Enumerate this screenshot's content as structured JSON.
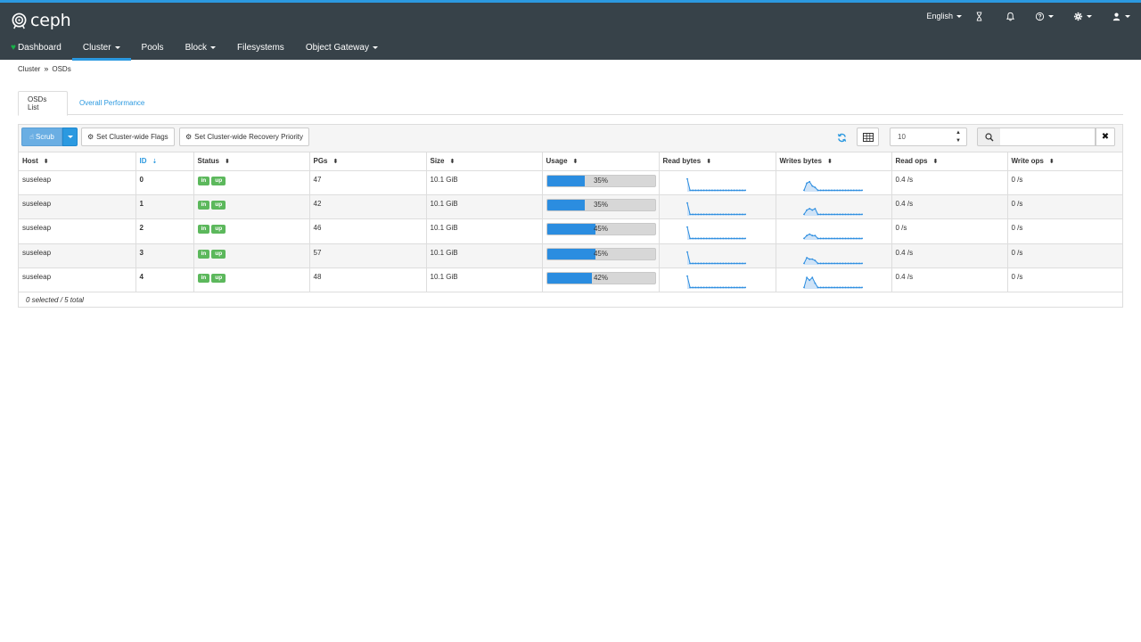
{
  "brand": {
    "name": "ceph"
  },
  "top_utils": {
    "language": "English"
  },
  "nav": {
    "dashboard": "Dashboard",
    "cluster": "Cluster",
    "pools": "Pools",
    "block": "Block",
    "filesystems": "Filesystems",
    "object_gateway": "Object Gateway"
  },
  "breadcrumb": {
    "parent": "Cluster",
    "current": "OSDs"
  },
  "tabs": {
    "osds_list": "OSDs List",
    "overall_performance": "Overall Performance"
  },
  "toolbar": {
    "scrub": "Scrub",
    "set_flags": "Set Cluster-wide Flags",
    "set_recovery": "Set Cluster-wide Recovery Priority",
    "page_limit": "10",
    "search_value": ""
  },
  "table": {
    "columns": {
      "host": "Host",
      "id": "ID",
      "status": "Status",
      "pgs": "PGs",
      "size": "Size",
      "usage": "Usage",
      "read_bytes": "Read bytes",
      "write_bytes": "Writes bytes",
      "read_ops": "Read ops",
      "write_ops": "Write ops"
    },
    "rows": [
      {
        "host": "suseleap",
        "id": "0",
        "status_in": "in",
        "status_up": "up",
        "pgs": "47",
        "size": "10.1 GiB",
        "usage_pct": 35,
        "usage_label": "35%",
        "read_ops": "0.4 /s",
        "write_ops": "0 /s",
        "read_spark": [
          9,
          1,
          1,
          1,
          1,
          1,
          1,
          1,
          1,
          1,
          1,
          1,
          1,
          1,
          1,
          1,
          1,
          1,
          1,
          1,
          1,
          1
        ],
        "write_spark": [
          1,
          6,
          7,
          4,
          3,
          1,
          1,
          1,
          1,
          1,
          1,
          1,
          1,
          1,
          1,
          1,
          1,
          1,
          1,
          1,
          1,
          1
        ]
      },
      {
        "host": "suseleap",
        "id": "1",
        "status_in": "in",
        "status_up": "up",
        "pgs": "42",
        "size": "10.1 GiB",
        "usage_pct": 35,
        "usage_label": "35%",
        "read_ops": "0.4 /s",
        "write_ops": "0 /s",
        "read_spark": [
          9,
          1,
          1,
          1,
          1,
          1,
          1,
          1,
          1,
          1,
          1,
          1,
          1,
          1,
          1,
          1,
          1,
          1,
          1,
          1,
          1,
          1
        ],
        "write_spark": [
          1,
          4,
          5,
          4,
          5,
          1,
          1,
          1,
          1,
          1,
          1,
          1,
          1,
          1,
          1,
          1,
          1,
          1,
          1,
          1,
          1,
          1
        ]
      },
      {
        "host": "suseleap",
        "id": "2",
        "status_in": "in",
        "status_up": "up",
        "pgs": "46",
        "size": "10.1 GiB",
        "usage_pct": 45,
        "usage_label": "45%",
        "read_ops": "0 /s",
        "write_ops": "0 /s",
        "read_spark": [
          9,
          1,
          1,
          1,
          1,
          1,
          1,
          1,
          1,
          1,
          1,
          1,
          1,
          1,
          1,
          1,
          1,
          1,
          1,
          1,
          1,
          1
        ],
        "write_spark": [
          1,
          3,
          4,
          3,
          3,
          1,
          1,
          1,
          1,
          1,
          1,
          1,
          1,
          1,
          1,
          1,
          1,
          1,
          1,
          1,
          1,
          1
        ]
      },
      {
        "host": "suseleap",
        "id": "3",
        "status_in": "in",
        "status_up": "up",
        "pgs": "57",
        "size": "10.1 GiB",
        "usage_pct": 45,
        "usage_label": "45%",
        "read_ops": "0.4 /s",
        "write_ops": "0 /s",
        "read_spark": [
          9,
          1,
          1,
          1,
          1,
          1,
          1,
          1,
          1,
          1,
          1,
          1,
          1,
          1,
          1,
          1,
          1,
          1,
          1,
          1,
          1,
          1
        ],
        "write_spark": [
          1,
          5,
          4,
          4,
          3,
          1,
          1,
          1,
          1,
          1,
          1,
          1,
          1,
          1,
          1,
          1,
          1,
          1,
          1,
          1,
          1,
          1
        ]
      },
      {
        "host": "suseleap",
        "id": "4",
        "status_in": "in",
        "status_up": "up",
        "pgs": "48",
        "size": "10.1 GiB",
        "usage_pct": 42,
        "usage_label": "42%",
        "read_ops": "0.4 /s",
        "write_ops": "0 /s",
        "read_spark": [
          9,
          1,
          1,
          1,
          1,
          1,
          1,
          1,
          1,
          1,
          1,
          1,
          1,
          1,
          1,
          1,
          1,
          1,
          1,
          1,
          1,
          1
        ],
        "write_spark": [
          1,
          8,
          6,
          8,
          4,
          1,
          1,
          1,
          1,
          1,
          1,
          1,
          1,
          1,
          1,
          1,
          1,
          1,
          1,
          1,
          1,
          1
        ]
      }
    ],
    "footer": "0 selected / 5 total"
  },
  "colors": {
    "navbar": "#374249",
    "accent": "#2b99e0",
    "badge_green": "#5cb85c",
    "heart": "#18b248"
  },
  "icons": {
    "brand": "ceph-logo-icon",
    "hourglass": "hourglass-icon",
    "bell": "bell-icon",
    "help": "question-circle-icon",
    "settings": "gear-icon",
    "user": "user-icon",
    "heart": "heart-icon",
    "refresh": "refresh-icon",
    "columns": "table-columns-icon",
    "search": "search-icon",
    "clear": "close-icon"
  }
}
